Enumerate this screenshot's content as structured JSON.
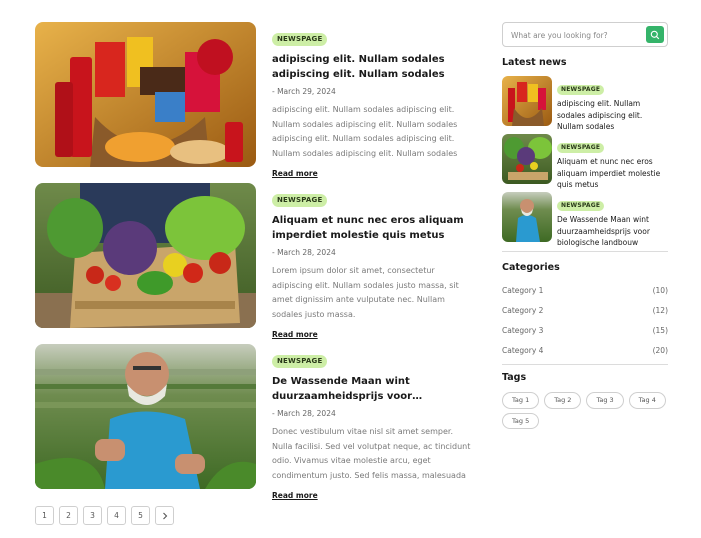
{
  "posts": [
    {
      "badge": "NEWSPAGE",
      "title": "adipiscing elit. Nullam sodales adipiscing elit. Nullam sodales",
      "date": "- March 29, 2024",
      "excerpt": "adipiscing elit. Nullam sodales adipiscing elit. Nullam sodales adipiscing elit. Nullam sodales adipiscing elit. Nullam sodales adipiscing elit. Nullam sodales adipiscing elit. Nullam sodales",
      "read_more": "Read more"
    },
    {
      "badge": "NEWSPAGE",
      "title": "Aliquam et nunc nec eros aliquam imperdiet molestie quis metus",
      "date": "- March 28, 2024",
      "excerpt": "Lorem ipsum dolor sit amet, consectetur adipiscing elit. Nullam sodales justo massa, sit amet dignissim ante vulputate nec. Nullam sodales justo massa.",
      "read_more": "Read more"
    },
    {
      "badge": "NEWSPAGE",
      "title": "De Wassende Maan wint duurzaamheidsprijs voor biologische...",
      "date": "- March 28, 2024",
      "excerpt": "Donec vestibulum vitae nisl sit amet semper. Nulla facilisi. Sed vel volutpat neque, ac tincidunt odio. Vivamus vitae molestie arcu, eget condimentum justo. Sed felis massa, malesuada a ut elementum...",
      "read_more": "Read more"
    }
  ],
  "pagination": [
    "1",
    "2",
    "3",
    "4",
    "5"
  ],
  "search": {
    "placeholder": "What are you looking for?"
  },
  "latest": {
    "title": "Latest news",
    "items": [
      {
        "badge": "NEWSPAGE",
        "title": "adipiscing elit. Nullam sodales adipiscing elit. Nullam sodales"
      },
      {
        "badge": "NEWSPAGE",
        "title": "Aliquam et nunc nec eros aliquam imperdiet molestie quis metus"
      },
      {
        "badge": "NEWSPAGE",
        "title": "De Wassende Maan wint duurzaamheidsprijs voor biologische landbouw"
      }
    ]
  },
  "categories": {
    "title": "Categories",
    "items": [
      {
        "name": "Category 1",
        "count": "(10)"
      },
      {
        "name": "Category 2",
        "count": "(12)"
      },
      {
        "name": "Category 3",
        "count": "(15)"
      },
      {
        "name": "Category 4",
        "count": "(20)"
      }
    ]
  },
  "tags": {
    "title": "Tags",
    "items": [
      "Tag 1",
      "Tag 2",
      "Tag 3",
      "Tag 4",
      "Tag 5"
    ]
  },
  "colors": {
    "badge_bg": "#cdeea6",
    "search_button": "#35b46a"
  }
}
